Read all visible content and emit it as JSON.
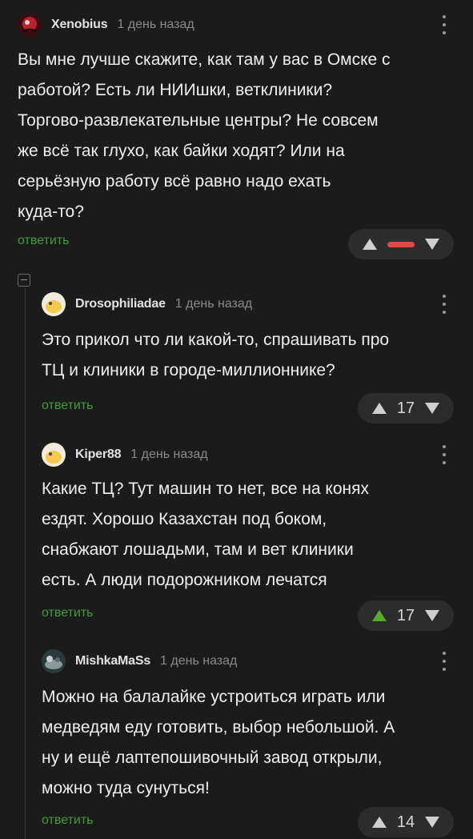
{
  "comments": [
    {
      "username": "Xenobius",
      "time": "1 день назад",
      "lines": [
        "Вы мне лучше скажите, как там у вас в Омске с",
        "работой? Есть ли НИИшки, ветклиники?",
        "Торгово-развлекательные центры? Не совсем",
        "же всё так глухо, как байки ходят? Или на",
        "серьёзную работу всё равно надо ехать",
        "куда-то?"
      ],
      "reply_label": "ответить",
      "score": "",
      "score_state": "negative"
    },
    {
      "username": "Drosophiliadae",
      "time": "1 день назад",
      "lines": [
        "Это прикол что ли какой-то, спрашивать про",
        "ТЦ и клиники в городе-миллионнике?"
      ],
      "reply_label": "ответить",
      "score": "17",
      "score_state": "neutral"
    },
    {
      "username": "Kiper88",
      "time": "1 день назад",
      "lines": [
        "Какие ТЦ? Тут машин то нет, все на конях",
        "ездят. Хорошо Казахстан под боком,",
        "снабжают лошадьми, там и вет клиники",
        "есть. А люди подорожником лечатся"
      ],
      "reply_label": "ответить",
      "score": "17",
      "score_state": "upvoted"
    },
    {
      "username": "MishkaMaSs",
      "time": "1 день назад",
      "lines": [
        "Можно на балалайке устроиться играть или",
        "медведям еду готовить, выбор небольшой. А",
        "ну и ещё лаптепошивочный завод открыли,",
        "можно туда сунуться!"
      ],
      "reply_label": "ответить",
      "score": "14",
      "score_state": "neutral"
    }
  ],
  "colors": {
    "background": "#1b1b1b",
    "reply_link": "#3f9d3a",
    "upvote_active": "#5aa92e",
    "negative_bar": "#e24848"
  }
}
